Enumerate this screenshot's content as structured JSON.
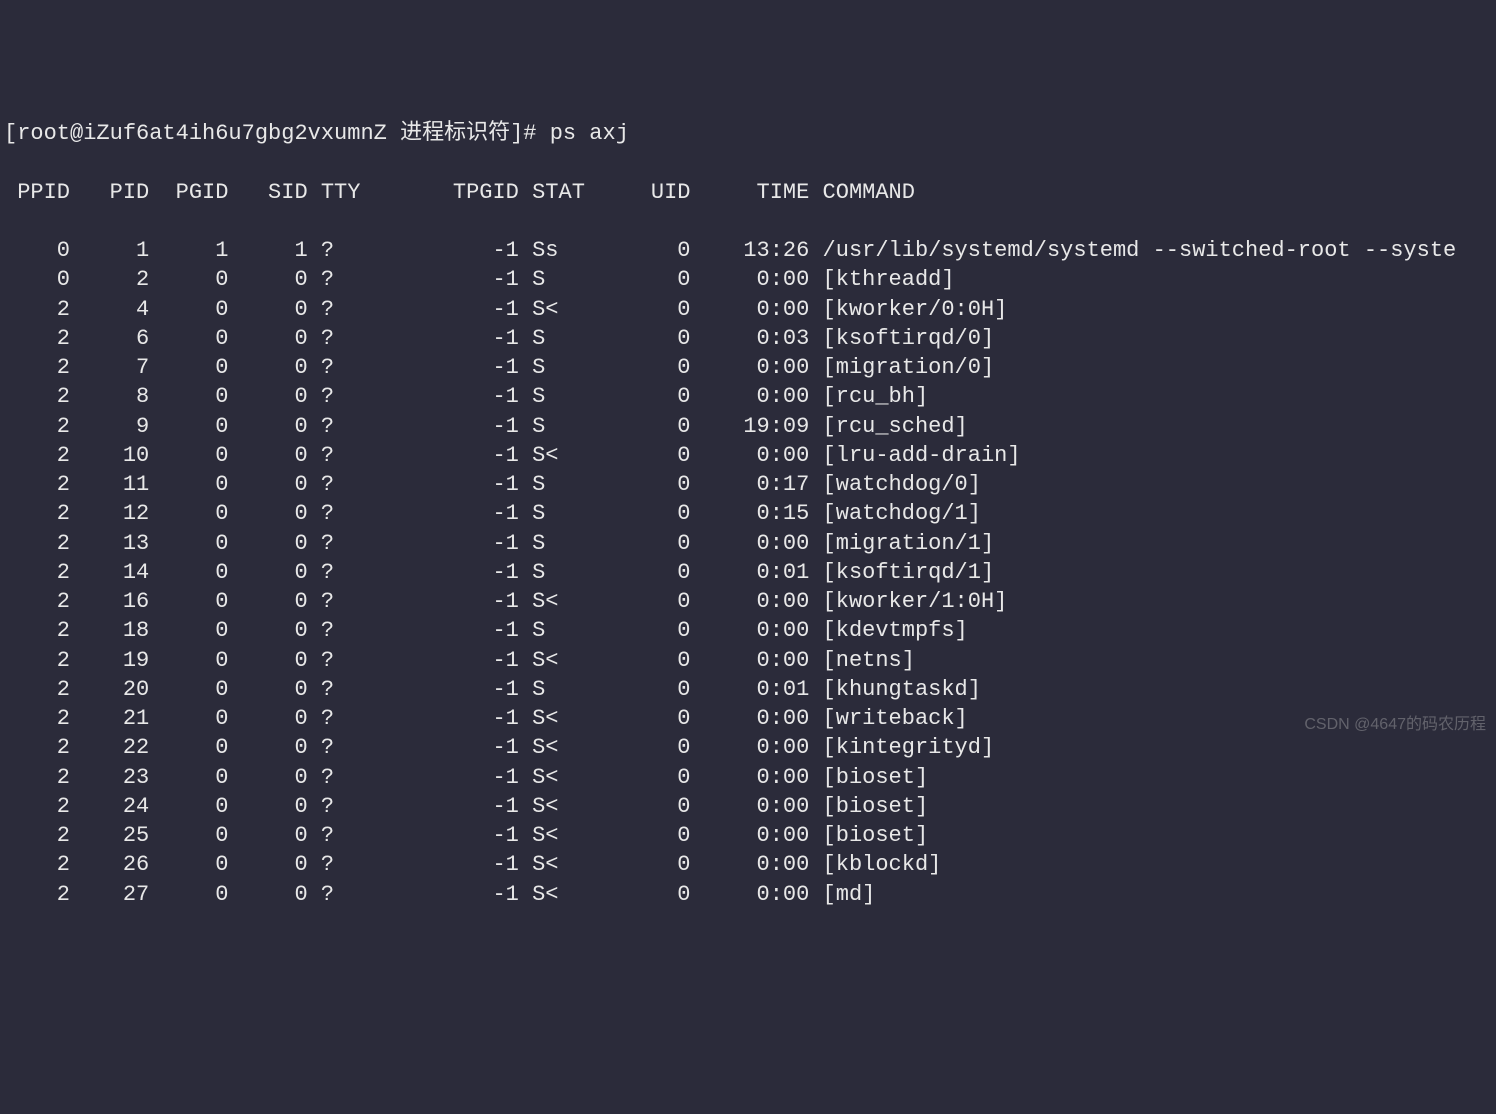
{
  "prompt": {
    "user_host": "[root@iZuf6at4ih6u7gbg2vxumnZ ",
    "cwd": "进程标识符",
    "suffix": "]# ",
    "command": "ps axj"
  },
  "columns": {
    "ppid": "PPID",
    "pid": "PID",
    "pgid": "PGID",
    "sid": "SID",
    "tty": "TTY",
    "tpgid": "TPGID",
    "stat": "STAT",
    "uid": "UID",
    "time": "TIME",
    "command": "COMMAND"
  },
  "rows": [
    {
      "ppid": "0",
      "pid": "1",
      "pgid": "1",
      "sid": "1",
      "tty": "?",
      "tpgid": "-1",
      "stat": "Ss",
      "uid": "0",
      "time": "13:26",
      "command": "/usr/lib/systemd/systemd --switched-root --syste"
    },
    {
      "ppid": "0",
      "pid": "2",
      "pgid": "0",
      "sid": "0",
      "tty": "?",
      "tpgid": "-1",
      "stat": "S",
      "uid": "0",
      "time": "0:00",
      "command": "[kthreadd]"
    },
    {
      "ppid": "2",
      "pid": "4",
      "pgid": "0",
      "sid": "0",
      "tty": "?",
      "tpgid": "-1",
      "stat": "S<",
      "uid": "0",
      "time": "0:00",
      "command": "[kworker/0:0H]"
    },
    {
      "ppid": "2",
      "pid": "6",
      "pgid": "0",
      "sid": "0",
      "tty": "?",
      "tpgid": "-1",
      "stat": "S",
      "uid": "0",
      "time": "0:03",
      "command": "[ksoftirqd/0]"
    },
    {
      "ppid": "2",
      "pid": "7",
      "pgid": "0",
      "sid": "0",
      "tty": "?",
      "tpgid": "-1",
      "stat": "S",
      "uid": "0",
      "time": "0:00",
      "command": "[migration/0]"
    },
    {
      "ppid": "2",
      "pid": "8",
      "pgid": "0",
      "sid": "0",
      "tty": "?",
      "tpgid": "-1",
      "stat": "S",
      "uid": "0",
      "time": "0:00",
      "command": "[rcu_bh]"
    },
    {
      "ppid": "2",
      "pid": "9",
      "pgid": "0",
      "sid": "0",
      "tty": "?",
      "tpgid": "-1",
      "stat": "S",
      "uid": "0",
      "time": "19:09",
      "command": "[rcu_sched]"
    },
    {
      "ppid": "2",
      "pid": "10",
      "pgid": "0",
      "sid": "0",
      "tty": "?",
      "tpgid": "-1",
      "stat": "S<",
      "uid": "0",
      "time": "0:00",
      "command": "[lru-add-drain]"
    },
    {
      "ppid": "2",
      "pid": "11",
      "pgid": "0",
      "sid": "0",
      "tty": "?",
      "tpgid": "-1",
      "stat": "S",
      "uid": "0",
      "time": "0:17",
      "command": "[watchdog/0]"
    },
    {
      "ppid": "2",
      "pid": "12",
      "pgid": "0",
      "sid": "0",
      "tty": "?",
      "tpgid": "-1",
      "stat": "S",
      "uid": "0",
      "time": "0:15",
      "command": "[watchdog/1]"
    },
    {
      "ppid": "2",
      "pid": "13",
      "pgid": "0",
      "sid": "0",
      "tty": "?",
      "tpgid": "-1",
      "stat": "S",
      "uid": "0",
      "time": "0:00",
      "command": "[migration/1]"
    },
    {
      "ppid": "2",
      "pid": "14",
      "pgid": "0",
      "sid": "0",
      "tty": "?",
      "tpgid": "-1",
      "stat": "S",
      "uid": "0",
      "time": "0:01",
      "command": "[ksoftirqd/1]"
    },
    {
      "ppid": "2",
      "pid": "16",
      "pgid": "0",
      "sid": "0",
      "tty": "?",
      "tpgid": "-1",
      "stat": "S<",
      "uid": "0",
      "time": "0:00",
      "command": "[kworker/1:0H]"
    },
    {
      "ppid": "2",
      "pid": "18",
      "pgid": "0",
      "sid": "0",
      "tty": "?",
      "tpgid": "-1",
      "stat": "S",
      "uid": "0",
      "time": "0:00",
      "command": "[kdevtmpfs]"
    },
    {
      "ppid": "2",
      "pid": "19",
      "pgid": "0",
      "sid": "0",
      "tty": "?",
      "tpgid": "-1",
      "stat": "S<",
      "uid": "0",
      "time": "0:00",
      "command": "[netns]"
    },
    {
      "ppid": "2",
      "pid": "20",
      "pgid": "0",
      "sid": "0",
      "tty": "?",
      "tpgid": "-1",
      "stat": "S",
      "uid": "0",
      "time": "0:01",
      "command": "[khungtaskd]"
    },
    {
      "ppid": "2",
      "pid": "21",
      "pgid": "0",
      "sid": "0",
      "tty": "?",
      "tpgid": "-1",
      "stat": "S<",
      "uid": "0",
      "time": "0:00",
      "command": "[writeback]"
    },
    {
      "ppid": "2",
      "pid": "22",
      "pgid": "0",
      "sid": "0",
      "tty": "?",
      "tpgid": "-1",
      "stat": "S<",
      "uid": "0",
      "time": "0:00",
      "command": "[kintegrityd]"
    },
    {
      "ppid": "2",
      "pid": "23",
      "pgid": "0",
      "sid": "0",
      "tty": "?",
      "tpgid": "-1",
      "stat": "S<",
      "uid": "0",
      "time": "0:00",
      "command": "[bioset]"
    },
    {
      "ppid": "2",
      "pid": "24",
      "pgid": "0",
      "sid": "0",
      "tty": "?",
      "tpgid": "-1",
      "stat": "S<",
      "uid": "0",
      "time": "0:00",
      "command": "[bioset]"
    },
    {
      "ppid": "2",
      "pid": "25",
      "pgid": "0",
      "sid": "0",
      "tty": "?",
      "tpgid": "-1",
      "stat": "S<",
      "uid": "0",
      "time": "0:00",
      "command": "[bioset]"
    },
    {
      "ppid": "2",
      "pid": "26",
      "pgid": "0",
      "sid": "0",
      "tty": "?",
      "tpgid": "-1",
      "stat": "S<",
      "uid": "0",
      "time": "0:00",
      "command": "[kblockd]"
    },
    {
      "ppid": "2",
      "pid": "27",
      "pgid": "0",
      "sid": "0",
      "tty": "?",
      "tpgid": "-1",
      "stat": "S<",
      "uid": "0",
      "time": "0:00",
      "command": "[md]"
    }
  ],
  "widths": {
    "ppid": 5,
    "pid": 6,
    "pgid": 6,
    "sid": 6,
    "tty": 9,
    "tpgid": 6,
    "stat": 5,
    "uid": 7,
    "time": 7
  },
  "watermark": "CSDN @4647的码农历程"
}
